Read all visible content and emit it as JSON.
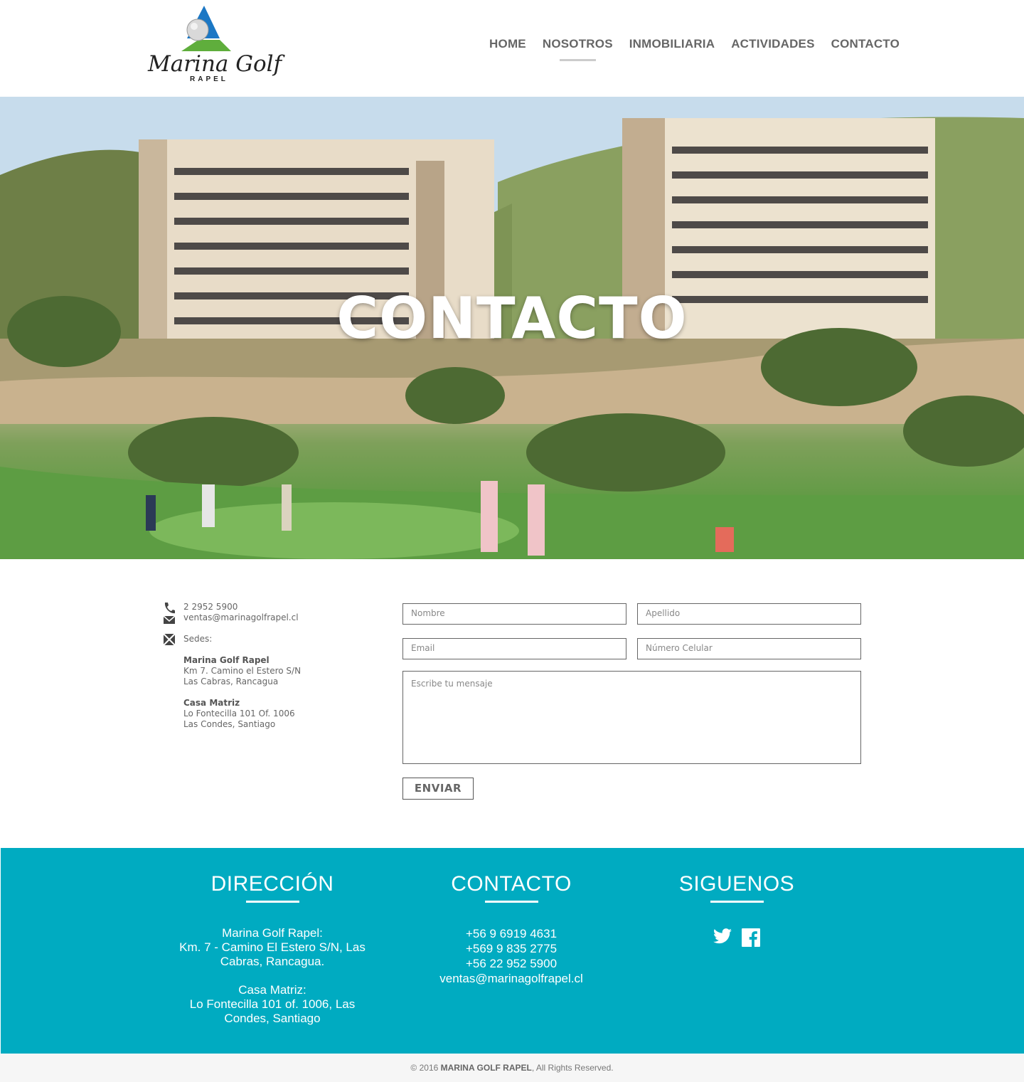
{
  "brand": {
    "name": "Marina Golf",
    "sub": "RAPEL",
    "colors": {
      "accent": "#00abc1",
      "logo_blue": "#1b77c4",
      "logo_green": "#5fae3c"
    }
  },
  "nav": {
    "items": [
      {
        "label": "HOME",
        "active": false
      },
      {
        "label": "NOSOTROS",
        "active": true
      },
      {
        "label": "INMOBILIARIA",
        "active": false
      },
      {
        "label": "ACTIVIDADES",
        "active": false
      },
      {
        "label": "CONTACTO",
        "active": false
      }
    ]
  },
  "hero": {
    "title": "CONTACTO"
  },
  "contact_info": {
    "phone": "2 2952 5900",
    "email": "ventas@marinagolfrapel.cl",
    "sedes_label": "Sedes:",
    "sede1": {
      "name": "Marina Golf Rapel",
      "line1": "Km 7. Camino el Estero S/N",
      "line2": "Las Cabras, Rancagua"
    },
    "sede2": {
      "name": "Casa Matriz",
      "line1": "Lo Fontecilla 101 Of. 1006",
      "line2": "Las Condes, Santiago"
    },
    "icons": [
      "phone-icon",
      "mail-icon",
      "map-icon"
    ]
  },
  "form": {
    "nombre_placeholder": "Nombre",
    "apellido_placeholder": "Apellido",
    "email_placeholder": "Email",
    "celular_placeholder": "Número Celular",
    "mensaje_placeholder": "Escribe tu mensaje",
    "submit_label": "ENVIAR"
  },
  "footer": {
    "direccion": {
      "title": "DIRECCIÓN",
      "l1": "Marina Golf Rapel:",
      "l2": "Km. 7 - Camino El Estero S/N, Las",
      "l3": "Cabras, Rancagua.",
      "l4": "Casa Matriz:",
      "l5": "Lo Fontecilla 101 of. 1006, Las",
      "l6": "Condes, Santiago"
    },
    "contacto": {
      "title": "CONTACTO",
      "l1": "+56 9 6919 4631",
      "l2": "+569 9 835 2775",
      "l3": "+56 22 952 5900",
      "l4": "ventas@marinagolfrapel.cl"
    },
    "siguenos": {
      "title": "SIGUENOS",
      "icons": [
        "twitter-icon",
        "facebook-icon"
      ]
    }
  },
  "copyright": {
    "prefix": "© 2016",
    "brand": "MARINA GOLF RAPEL",
    "suffix": ", All Rights Reserved."
  }
}
